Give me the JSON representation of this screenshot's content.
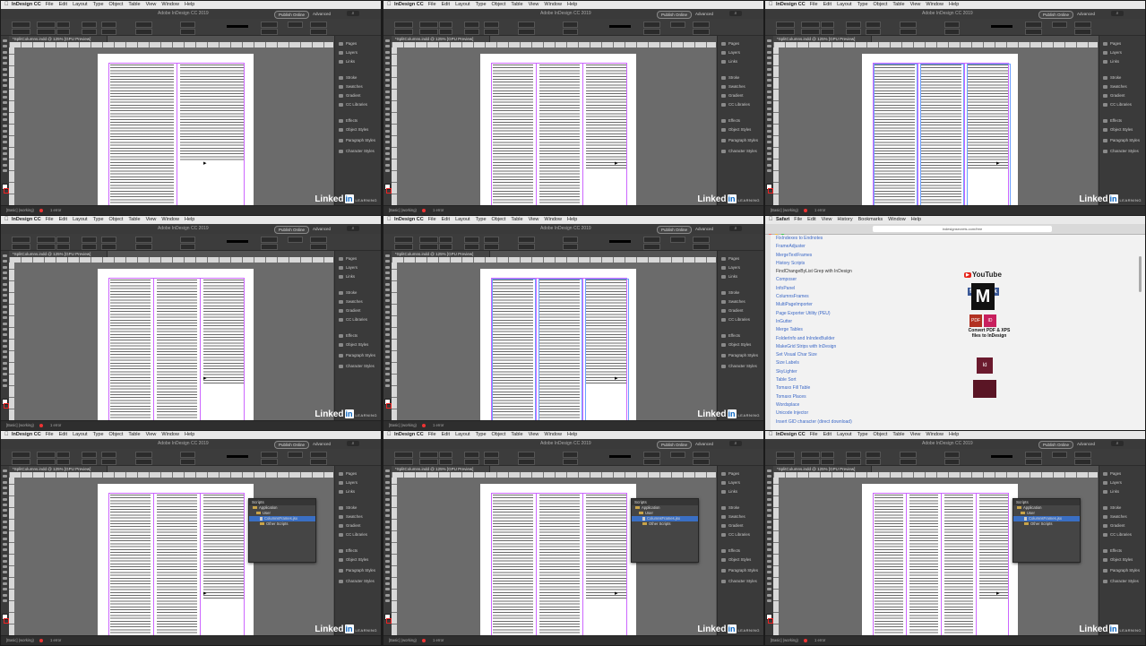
{
  "indesign": {
    "app_name": "InDesign CC",
    "menu": [
      "File",
      "Edit",
      "Layout",
      "Type",
      "Object",
      "Table",
      "View",
      "Window",
      "Help"
    ],
    "window_title": "Adobe InDesign CC 2019",
    "publish_label": "Publish Online",
    "advanced_label": "Advanced",
    "doc_tab": "*SplitColumns.indd @ 125% [GPU Preview]",
    "zoom": "125%",
    "panels": [
      "Pages",
      "Layers",
      "Links",
      "Stroke",
      "Swatches",
      "Gradient",
      "CC Libraries",
      "Effects",
      "Object Styles",
      "Paragraph Styles",
      "Character Styles"
    ],
    "status": {
      "style": "[Basic] (working)",
      "errors": "1 error"
    }
  },
  "linkedin": {
    "brand": "Linked",
    "in": "in",
    "learning": "LEARNING"
  },
  "scripts_panel": {
    "title": "Scripts",
    "rows": [
      "Application",
      "User",
      "ColumnsFrames.jsx",
      "Other Scripts"
    ]
  },
  "safari": {
    "app_name": "Safari",
    "menu": [
      "File",
      "Edit",
      "View",
      "History",
      "Bookmarks",
      "Window",
      "Help"
    ],
    "url": "indesignsecrets.com/free",
    "links": [
      "FixIndexes to Endnotes",
      "FrameAdjuster",
      "MergeTextFrames",
      "History Scripts",
      "FindChangeByList Grep with InDesign",
      "Composer",
      "InfoPanel",
      "ColumnsFrames",
      "MultiPageImporter",
      "Page Exporter Utility (PEU)",
      "InGutter",
      "Merge Tables",
      "FolderInfo and InIndexBuilder",
      "MakeGrid Strips with InDesign",
      "Set Visual Char Size",
      "Size Labels",
      "SkyLighter",
      "Table Sort",
      "Tomaxx Fill Table",
      "Tomaxx Places",
      "Wordsplace",
      "Unicode Injector",
      "Insert GID character (direct download)"
    ],
    "ads": {
      "youtube": "YouTube",
      "facebook": "facebook",
      "mg": "M",
      "pdf1": "PDF",
      "pdf2": "ID",
      "convert": "Convert PDF & XPS files to InDesign",
      "id_logo": "Id"
    }
  },
  "colors": {
    "accent": "#3a6fc4",
    "margin_guide": "#cc66ff",
    "frame_edge": "#6aa0ff",
    "workspace": "#535353"
  }
}
